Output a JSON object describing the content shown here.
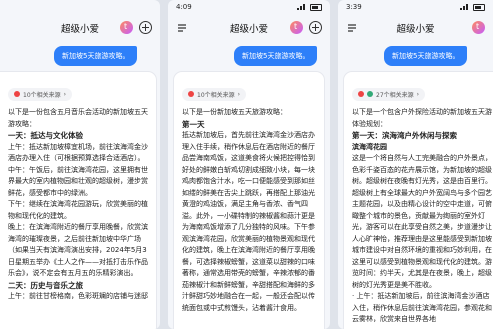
{
  "app": {
    "title": "超级小爱",
    "user_query": "新加坡5天旅游攻略。"
  },
  "panel1": {
    "sources_label": "10个相关来源",
    "intro": "以下是一份包含五月音乐会活动的新加坡五天游攻略：",
    "lines": [
      {
        "type": "h",
        "text": "一天：抵达与文化体验"
      },
      {
        "type": "t",
        "text": "上午：抵达新加坡樟宜机场，前往滨海湾金沙酒店办理入住（可根据预算选择合适酒店）。"
      },
      {
        "type": "t",
        "text": "中午：午饭后，前往滨海湾花园，这里拥有世界最大的室内植物园和壮观的超级树，漫步赏鲜花，感受都市中的绿洲。"
      },
      {
        "type": "t",
        "text": "下午：继续在滨海湾花园游玩，欣赏美丽的植物和现代化的建筑。"
      },
      {
        "type": "t",
        "text": "晚上：在滨海湾附近的餐厅享用晚餐，欣赏滨海湾的璀璨夜景，之后前往新加坡中华广场（如果当天有滨海湾演出安排，2024年5月3日星期五举办《土人之作——对抵打击乐作品乐会》，说不定会有五月五的乐精彩演出。"
      },
      {
        "type": "h",
        "text": "二天：历史与音乐之旅"
      },
      {
        "type": "t",
        "text": "上午：前往甘榜格南，色彩斑斓的店铺与迷邸"
      }
    ]
  },
  "panel2": {
    "status_time": "4:09",
    "sources_label": "10个相关来源",
    "intro": "以下是一份新加坡五天旅游攻略：",
    "lines": [
      {
        "type": "h",
        "text": "第一天"
      },
      {
        "type": "t",
        "text": "抵达新加坡后，首先前往滨海湾金沙酒店办理入住手续，稍作休息后在酒店附近的餐厅品尝海南鸡饭，这道美食将火候把控得恰到好处的鲜嫩白斩鸡切割成细致小块，每一块鸡肉都饱含汁水，吃一口便能感受到那如丝如缕的鲜美在舌尖上跳跃，再搭配上那油光黄澄的鸡油饭，满足主角与香浓、香气四溢。此外，一小碟特制的辣椒酱和蒜汁更是为海南鸡饭增添了几分独特的风味。下午参观滨海湾花园，欣赏美丽的植物景观和现代化的建筑，晚上在滨海湾附近的餐厅享用晚餐，可选择辣椒螃蟹，这道菜以甜辣的口味著称，通常选用带壳的螃蟹，辛辣浓郁的番茄辣椒汁和新鲜螃蟹，辛甜搭配和海鲜的多汁鲜甜巧妙地融合在一起，一般还会配以传统面包或中式煎馒头，沾着酱汁食用。"
      }
    ]
  },
  "panel3": {
    "status_time": "3:39",
    "sources_label": "27个相关来源",
    "intro": "以下是一个包含户外探险活动的新加坡五天游体验规划：",
    "lines": [
      {
        "type": "h",
        "text": "第一天：滨海湾户外休闲与探索"
      },
      {
        "type": "sub",
        "text": "滨海湾花园"
      },
      {
        "type": "t",
        "text": "这是一个将自然与人工完美融合的户外景点，色彩千姿百态的花卉展示馆，为新加坡的超级树。超级树在夜晚有灯光秀，这是由百里行。超级树上有全球最大的户外宽阔鸟与多个园艺主题花园，以及由精心设计的空中走道，可俯瞰整个城市的景色，贡献最为绚丽的室外灯光，游客可以在此享受自然之美，步道漫步让人心旷神怡，推荐理由是这里能感受到新加坡城市建设中对自然环境的重视和巧妙利用，在这里可以感受到植物景观和现代化的建筑。游览时间：约半天，尤其是在夜景，晚上，超级树的灯光秀更是美不胜收。"
      },
      {
        "type": "t",
        "text": "· 上午：抵达新加坡后，前往滨海湾金沙酒店入住，稍作休息后前往滨海湾花园，参观花和云雾林，欣赏来自世界各地"
      }
    ]
  }
}
